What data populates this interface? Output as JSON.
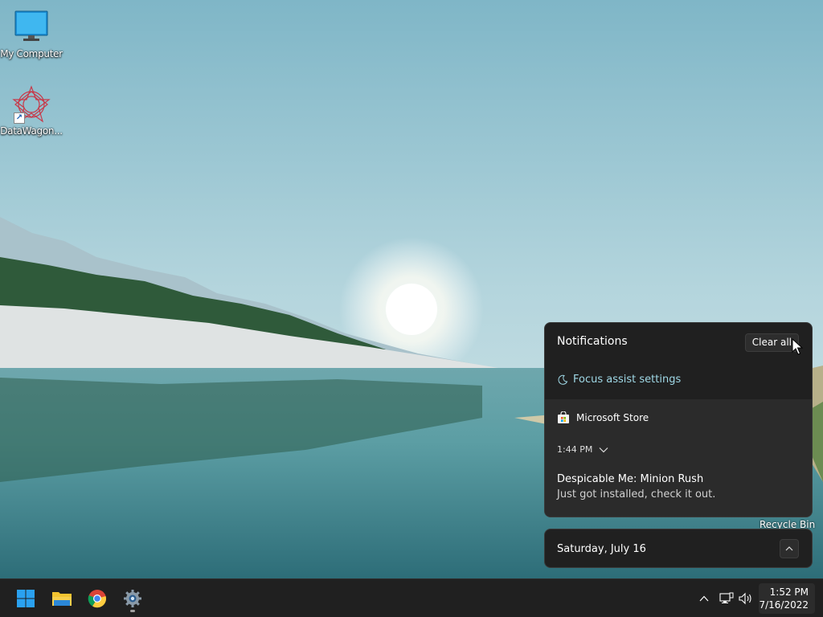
{
  "desktop": {
    "icons": [
      {
        "label": "My Computer",
        "icon": "monitor-icon"
      },
      {
        "label": "DataWagon...",
        "icon": "datawagon-icon"
      }
    ],
    "recycle_bin_label": "Recycle Bin"
  },
  "notifications": {
    "title": "Notifications",
    "clear_all": "Clear all",
    "focus_assist": "Focus assist settings",
    "items": [
      {
        "app": "Microsoft Store",
        "time": "1:44 PM",
        "title": "Despicable Me: Minion Rush",
        "body": "Just got installed, check it out."
      }
    ]
  },
  "calendar": {
    "date": "Saturday, July 16"
  },
  "taskbar": {
    "pinned": [
      {
        "name": "Start",
        "icon": "windows-logo-icon"
      },
      {
        "name": "File Explorer",
        "icon": "folder-icon"
      },
      {
        "name": "Google Chrome",
        "icon": "chrome-icon"
      },
      {
        "name": "Settings",
        "icon": "gear-icon"
      }
    ],
    "tray": [
      "chevron-up-icon",
      "network-icon",
      "volume-icon"
    ],
    "clock": {
      "time": "1:52 PM",
      "date": "7/16/2022"
    }
  },
  "colors": {
    "panel_bg": "#202020",
    "accent_teal": "#9fd8e6",
    "taskbar_bg": "#202020"
  }
}
